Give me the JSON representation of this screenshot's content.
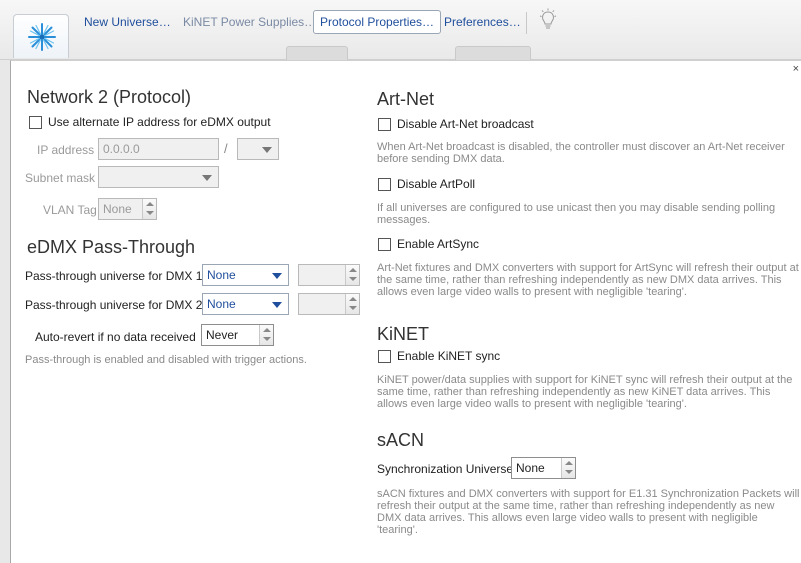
{
  "toolbar": {
    "logo_icon": "starburst-logo-icon",
    "new_universe": "New Universe…",
    "kinet_power_supplies": "KiNET Power Supplies…",
    "protocol_properties": "Protocol Properties…",
    "preferences": "Preferences…",
    "bulb_icon": "lightbulb-icon"
  },
  "panel": {
    "close_label": "×",
    "network": {
      "title": "Network 2 (Protocol)",
      "alt_ip_label": "Use alternate IP address for eDMX output",
      "alt_ip_checked": false,
      "ip_label": "IP address",
      "ip_value": "0.0.0.0",
      "ip_separator": "/",
      "subnet_label": "Subnet mask",
      "vlan_label": "VLAN Tag",
      "vlan_value": "None"
    },
    "edmx": {
      "title": "eDMX Pass-Through",
      "dmx1_label": "Pass-through universe for DMX 1",
      "dmx1_value": "None",
      "dmx2_label": "Pass-through universe for DMX 2",
      "dmx2_value": "None",
      "auto_revert_label": "Auto-revert if no data received",
      "auto_revert_value": "Never",
      "note": "Pass-through is enabled and disabled with trigger actions."
    },
    "artnet": {
      "title": "Art-Net",
      "disable_broadcast_label": "Disable Art-Net broadcast",
      "disable_broadcast_desc": "When Art-Net broadcast is disabled, the controller must discover an Art-Net receiver before sending DMX data.",
      "disable_artpoll_label": "Disable ArtPoll",
      "disable_artpoll_desc": "If all universes are configured to use unicast then you may disable sending polling messages.",
      "enable_artsync_label": "Enable ArtSync",
      "enable_artsync_desc": "Art-Net fixtures and DMX converters with support for ArtSync will refresh their output at the same time, rather than refreshing independently as new DMX data arrives. This allows even large video walls to present with negligible 'tearing'."
    },
    "kinet": {
      "title": "KiNET",
      "enable_sync_label": "Enable KiNET sync",
      "enable_sync_desc": "KiNET power/data supplies with support for KiNET sync will refresh their output at the same time, rather than refreshing independently as new KiNET data arrives. This allows even large video walls to present with negligible 'tearing'."
    },
    "sacn": {
      "title": "sACN",
      "sync_universe_label": "Synchronization Universe",
      "sync_universe_value": "None",
      "desc": "sACN fixtures and DMX converters with support for E1.31 Synchronization Packets will refresh their output at the same time, rather than refreshing independently as new DMX data arrives. This allows even large video walls to present with negligible 'tearing'."
    }
  }
}
